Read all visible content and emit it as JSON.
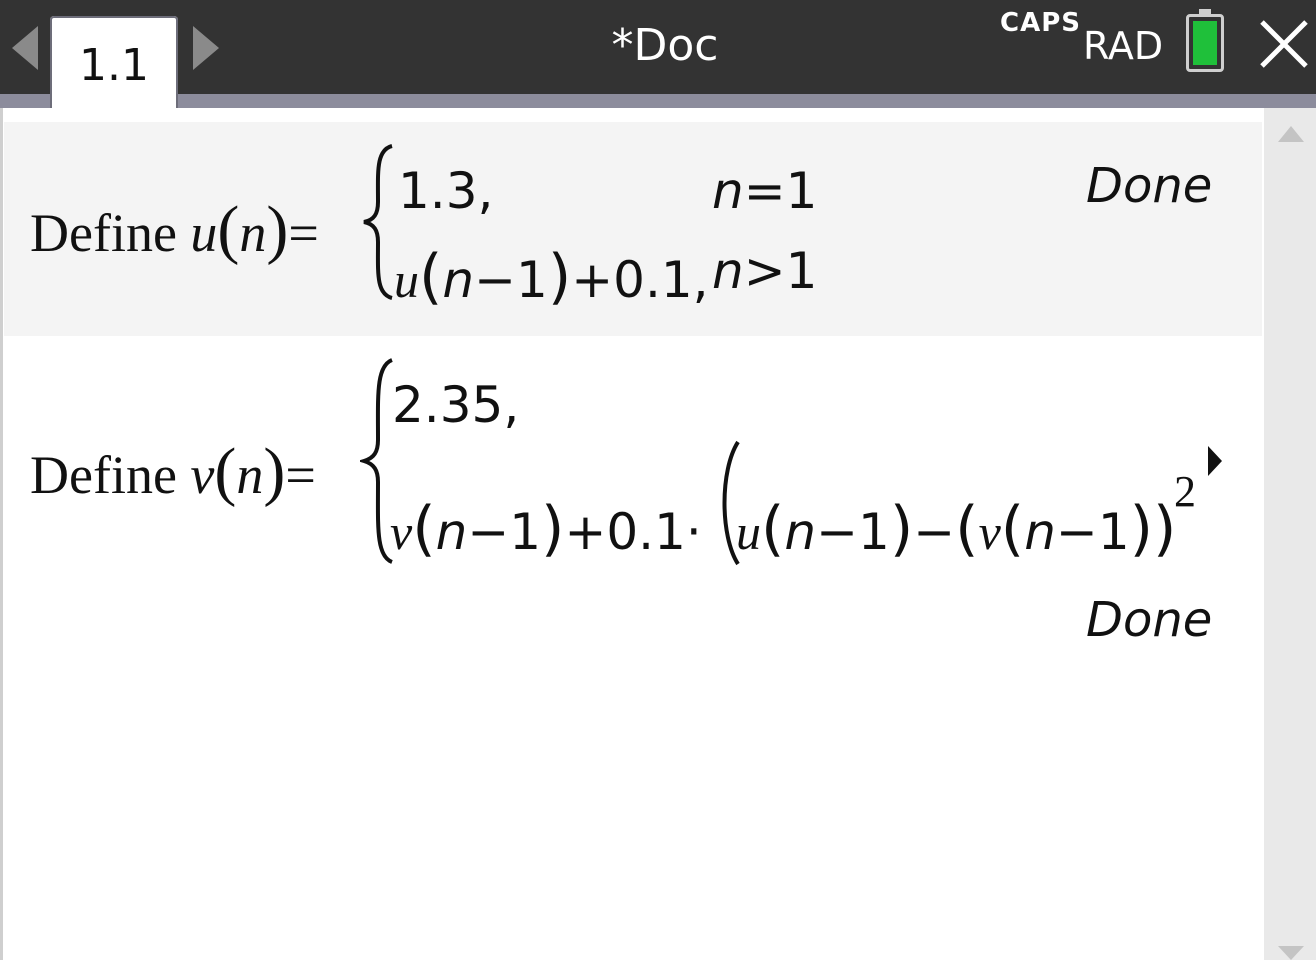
{
  "topbar": {
    "tab_label": "1.1",
    "doc_title": "*Doc",
    "caps": "CAPS",
    "angle_mode": "RAD"
  },
  "entries": [
    {
      "define": "Define",
      "func": "u",
      "arg": "n",
      "eq": "=",
      "case1_value": "1.3,",
      "case1_cond_var": "n",
      "case1_cond_rest": "=1",
      "case2_func": "u",
      "case2_arg_var": "n",
      "case2_arg_rest": "−1",
      "case2_rest": "+0.1,",
      "case2_cond_var": "n",
      "case2_cond_rest": ">1",
      "result": "Done"
    },
    {
      "define": "Define",
      "func": "v",
      "arg": "n",
      "eq": "=",
      "case1_value": "2.35,",
      "case2_func": "v",
      "case2_arg_var": "n",
      "case2_arg_rest": "−1",
      "case2_mid": "+0.1·",
      "inner_u": "u",
      "inner_u_arg_var": "n",
      "inner_u_arg_rest": "−1",
      "minus": "−",
      "inner_v": "v",
      "inner_v_arg_var": "n",
      "inner_v_arg_rest": "−1",
      "exponent": "2",
      "result": "Done"
    }
  ],
  "icons": {
    "battery_color": "#1fc03a",
    "close": "close-icon",
    "nav_left": "arrow-left-icon",
    "nav_right": "arrow-right-icon"
  }
}
